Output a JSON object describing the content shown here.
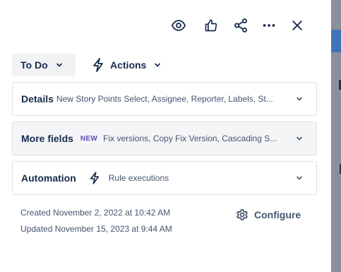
{
  "toolbar": {
    "watch_icon": "eye-icon",
    "vote_icon": "thumbs-up-icon",
    "share_icon": "share-icon",
    "more_icon": "more-horizontal-icon",
    "close_icon": "close-icon"
  },
  "status": {
    "label": "To Do"
  },
  "actions": {
    "label": "Actions",
    "icon": "lightning-bolt-icon"
  },
  "sections": {
    "details": {
      "title": "Details",
      "summary": "New Story Points Select, Assignee, Reporter, Labels, St..."
    },
    "more_fields": {
      "title": "More fields",
      "badge": "NEW",
      "summary": "Fix versions, Copy Fix Version, Cascading S..."
    },
    "automation": {
      "title": "Automation",
      "summary": "Rule executions"
    }
  },
  "meta": {
    "created": "Created November 2, 2022 at 10:42 AM",
    "updated": "Updated November 15, 2023 at 9:44 AM"
  },
  "configure": {
    "label": "Configure",
    "icon": "gear-icon"
  },
  "colors": {
    "text_primary": "#172b4d",
    "text_subtle": "#44546f",
    "new_badge": "#5e4db2",
    "status_bg": "#f1f2f4",
    "border": "#dfe1e6",
    "backdrop": "#8a8f99"
  }
}
